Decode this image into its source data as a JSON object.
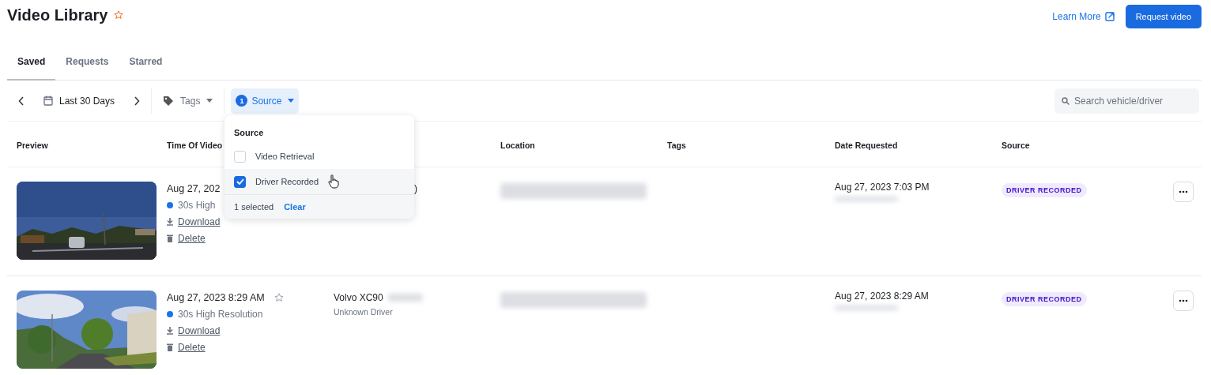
{
  "header": {
    "title": "Video Library",
    "starred": false,
    "learn_more": "Learn More",
    "request_button": "Request video"
  },
  "tabs": [
    {
      "label": "Saved",
      "selected": true
    },
    {
      "label": "Requests",
      "selected": false
    },
    {
      "label": "Starred",
      "selected": false
    }
  ],
  "filters": {
    "date_range": "Last 30 Days",
    "tags": "Tags",
    "source": {
      "label": "Source",
      "count": "1",
      "open": true
    },
    "search": {
      "placeholder": "Search vehicle/driver"
    }
  },
  "table": {
    "columns": [
      "Preview",
      "Time Of Video",
      "Location",
      "Tags",
      "Date Requested",
      "Source"
    ],
    "rows": [
      {
        "time": "Aug 27, 202",
        "resolution": "30s High",
        "download": "Download",
        "delete": "Delete",
        "vehicle": ")",
        "covered": true,
        "location_blurred": true,
        "date_requested": "Aug 27, 2023 7:03 PM",
        "requester_blurred": true,
        "source": "DRIVER RECORDED"
      },
      {
        "time": "Aug 27, 2023 8:29 AM",
        "starred": false,
        "resolution": "30s High Resolution",
        "download": "Download",
        "delete": "Delete",
        "vehicle": "Volvo XC90",
        "vehicle_blurred": true,
        "driver": "Unknown Driver",
        "covered": false,
        "location_blurred": true,
        "date_requested": "Aug 27, 2023 8:29 AM",
        "requester_blurred": true,
        "source": "DRIVER RECORDED"
      }
    ]
  },
  "source_menu": {
    "title": "Source",
    "options": [
      {
        "label": "Video Retrieval",
        "checked": false,
        "hovered": false
      },
      {
        "label": "Driver Recorded",
        "checked": true,
        "hovered": true
      }
    ],
    "summary": "1 selected",
    "clear": "Clear"
  }
}
